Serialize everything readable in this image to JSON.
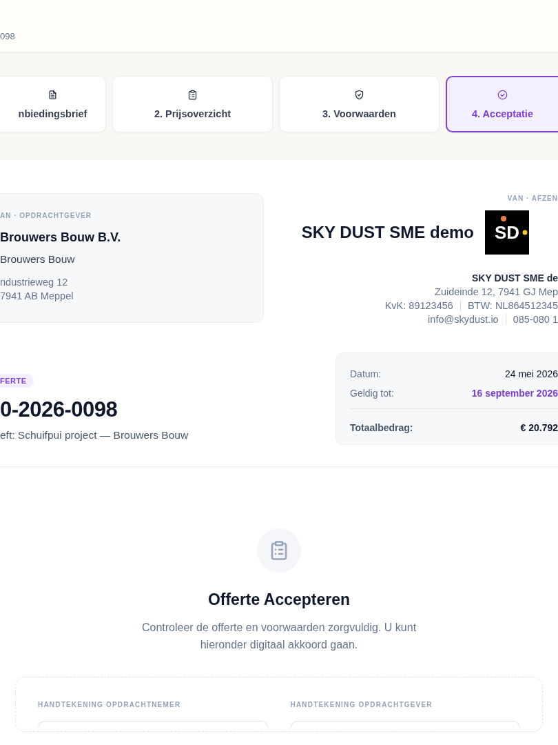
{
  "header": {
    "reference": "098"
  },
  "steps": [
    {
      "kind": "document",
      "label": "nbiedingsbrief",
      "selected": false
    },
    {
      "kind": "clipboard",
      "label": "2. Prijsoverzicht",
      "selected": false
    },
    {
      "kind": "shield",
      "label": "3. Voorwaarden",
      "selected": false
    },
    {
      "kind": "check-circle",
      "label": "4. Acceptatie",
      "selected": true
    }
  ],
  "client": {
    "label": "AN · OPDRACHTGEVER",
    "company": "Brouwers Bouw B.V.",
    "contact": "Brouwers Bouw",
    "address_lines": [
      "ndustrieweg 12",
      "7941 AB Meppel"
    ]
  },
  "sender": {
    "label": "VAN · AFZEN",
    "company": "SKY DUST SME demo",
    "logo_text": "SD",
    "name": "SKY DUST SME de",
    "address": "Zuideinde 12, 7941 GJ Mep",
    "detail_lines": [
      [
        "KvK: 89123456",
        "BTW: NL864512345"
      ],
      [
        "info@skydust.io",
        "085-080 1"
      ]
    ]
  },
  "quote": {
    "badge": "FERTE",
    "number": "0-2026-0098",
    "subject": "eft: Schuifpui project — Brouwers Bouw"
  },
  "summary": [
    {
      "kind": "plain",
      "label": "Datum:",
      "value": "24 mei 2026"
    },
    {
      "kind": "highlight",
      "label": "Geldig tot:",
      "value": "16 september 2026"
    },
    {
      "kind": "total",
      "label": "Totaalbedrag:",
      "value": "€ 20.792"
    }
  ],
  "accept": {
    "title": "Offerte Accepteren",
    "description": "Controleer de offerte en voorwaarden zorgvuldig. U kunt hieronder digitaal akkoord gaan.",
    "signatures": [
      {
        "label": "HANDTEKENING OPDRACHTNEMER"
      },
      {
        "label": "HANDTEKENING OPDRACHTGEVER"
      }
    ]
  }
}
